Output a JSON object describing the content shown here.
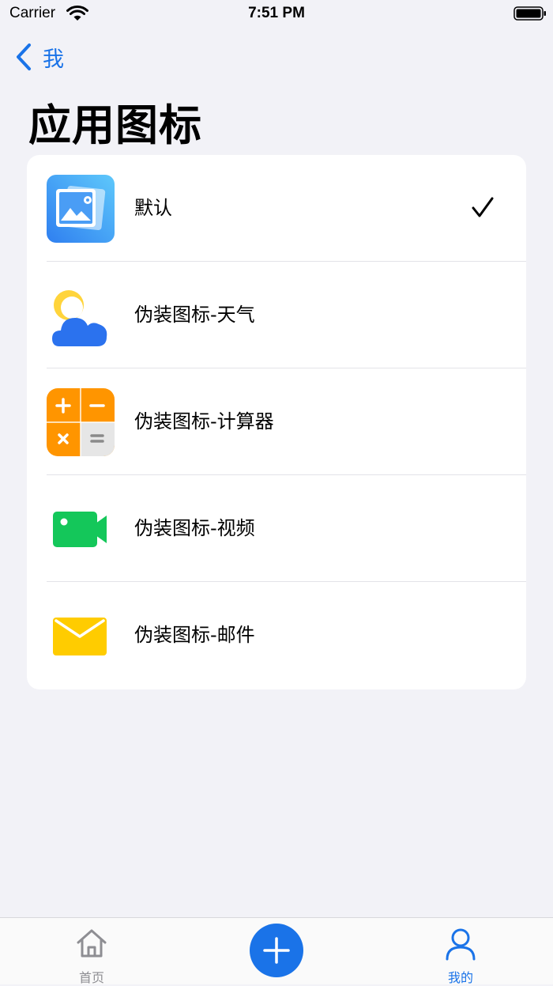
{
  "status_bar": {
    "carrier": "Carrier",
    "time": "7:51 PM"
  },
  "nav": {
    "back_label": "我"
  },
  "page": {
    "title": "应用图标"
  },
  "icons": [
    {
      "label": "默认",
      "icon": "gallery-app-icon",
      "selected": true
    },
    {
      "label": "伪装图标-天气",
      "icon": "weather-app-icon",
      "selected": false
    },
    {
      "label": "伪装图标-计算器",
      "icon": "calculator-app-icon",
      "selected": false
    },
    {
      "label": "伪装图标-视频",
      "icon": "video-app-icon",
      "selected": false
    },
    {
      "label": "伪装图标-邮件",
      "icon": "mail-app-icon",
      "selected": false
    }
  ],
  "tabbar": {
    "home_label": "首页",
    "me_label": "我的"
  },
  "colors": {
    "accent": "#1a73e8",
    "background": "#f2f2f7",
    "calculator_orange": "#ff9500",
    "video_green": "#14c75a",
    "mail_yellow": "#ffcc00"
  }
}
